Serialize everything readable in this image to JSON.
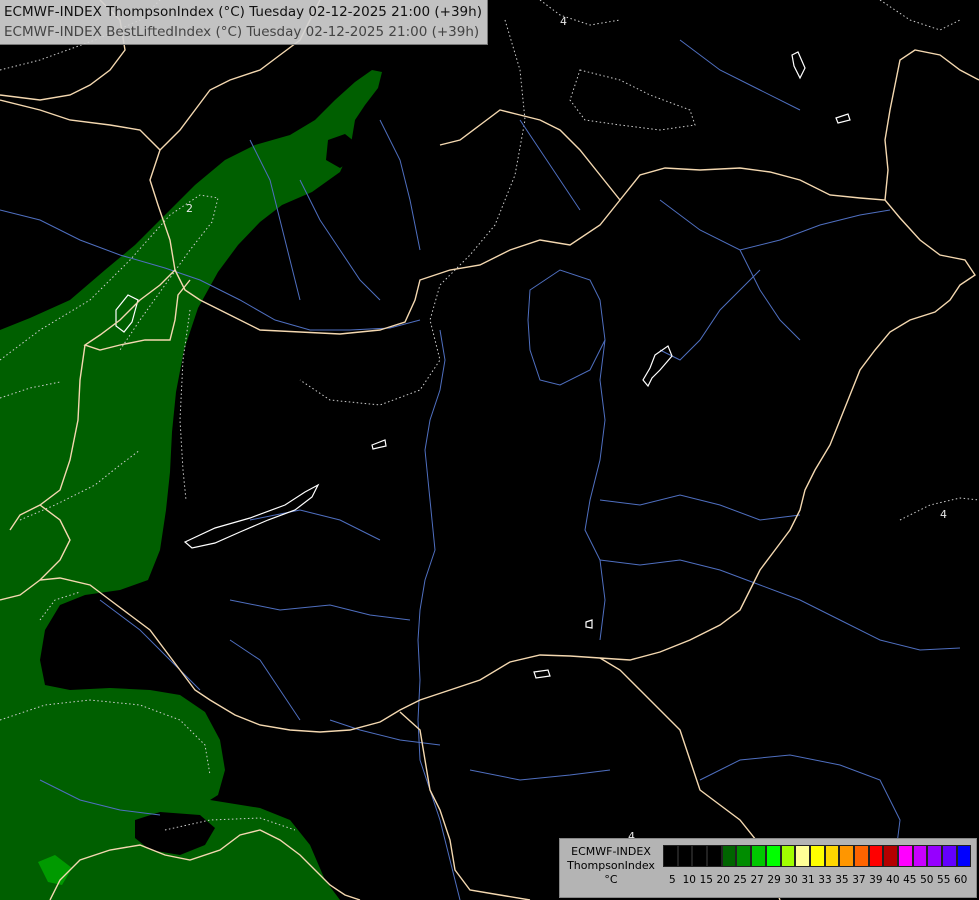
{
  "header": {
    "line1": "ECMWF-INDEX ThompsonIndex (°C) Tuesday 02-12-2025 21:00 (+39h)",
    "line2": "ECMWF-INDEX BestLiftedIndex (°C) Tuesday 02-12-2025 21:00 (+39h)"
  },
  "legend": {
    "title_lines": [
      "ECMWF-INDEX",
      "ThompsonIndex",
      "°C"
    ],
    "colors": [
      "#000000",
      "#000000",
      "#000000",
      "#000000",
      "#006400",
      "#008c00",
      "#00c800",
      "#00ff00",
      "#a0ff00",
      "#ffff96",
      "#ffff00",
      "#ffd700",
      "#ff9600",
      "#ff6400",
      "#ff0000",
      "#b40000",
      "#ff00ff",
      "#c800ff",
      "#9600ff",
      "#6400ff",
      "#0000ff"
    ],
    "ticks": [
      "5",
      "10",
      "15",
      "20",
      "25",
      "27",
      "29",
      "30",
      "31",
      "33",
      "35",
      "37",
      "39",
      "40",
      "45",
      "50",
      "55",
      "60"
    ]
  },
  "map": {
    "contour_labels": [
      "2",
      "4",
      "4",
      "4"
    ],
    "colors": {
      "background": "#000000",
      "fill_green": "#005f00",
      "fill_green_light": "#009a00",
      "border": "#f4d8b0",
      "river": "#4f6fc0",
      "contour": "#cfcfcf",
      "lake": "#ffffff"
    }
  }
}
